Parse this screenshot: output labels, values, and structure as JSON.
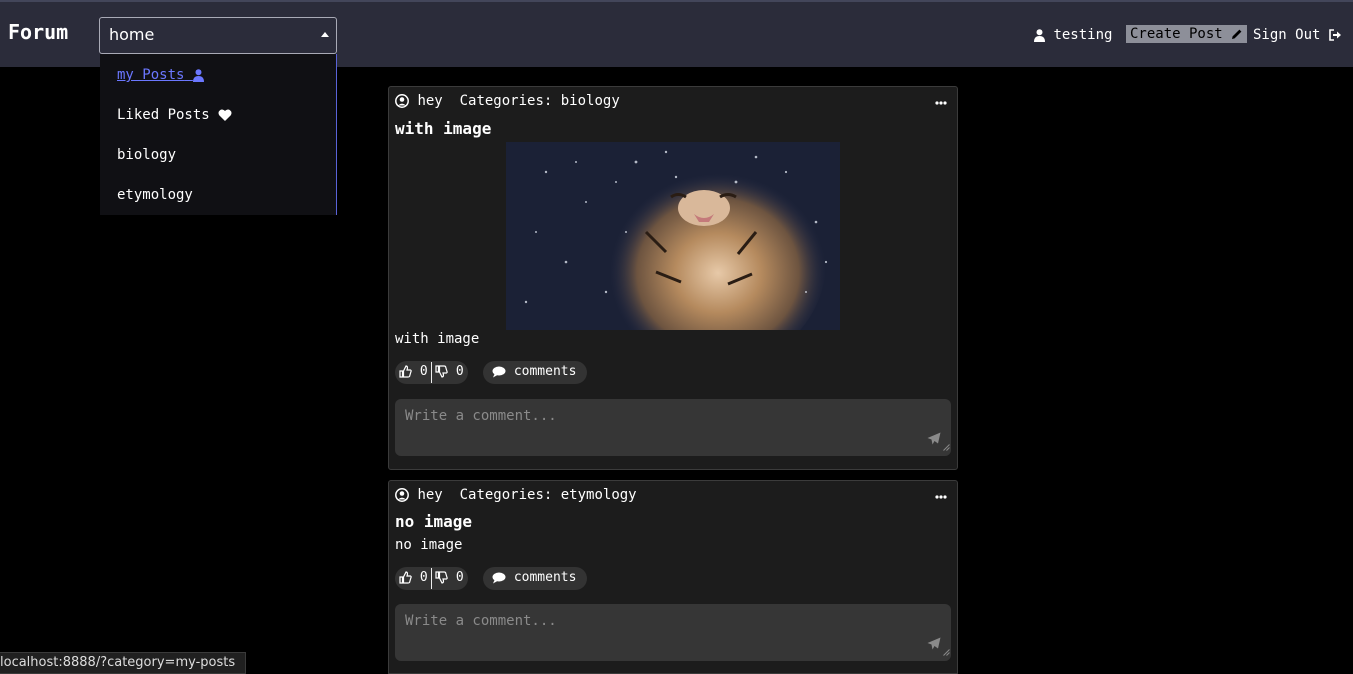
{
  "header": {
    "brand": "Forum",
    "category_select": {
      "value": "home"
    },
    "user_name": "testing",
    "create_post_label": "Create Post",
    "sign_out_label": "Sign Out"
  },
  "dropdown": {
    "items": [
      {
        "label": "my Posts",
        "icon": "user-icon"
      },
      {
        "label": "Liked Posts",
        "icon": "heart-icon"
      },
      {
        "label": "biology"
      },
      {
        "label": "etymology"
      }
    ]
  },
  "posts": [
    {
      "author": "hey",
      "categories_label": "Categories:",
      "category": "biology",
      "title": "with image",
      "image": "tiger shaking off water",
      "body": "with image",
      "likes": "0",
      "dislikes": "0",
      "comments_label": "comments",
      "comment_placeholder": "Write a comment..."
    },
    {
      "author": "hey",
      "categories_label": "Categories:",
      "category": "etymology",
      "title": "no image",
      "body": "no image",
      "likes": "0",
      "dislikes": "0",
      "comments_label": "comments",
      "comment_placeholder": "Write a comment..."
    }
  ],
  "status_bar": {
    "url": "localhost:8888/?category=my-posts"
  },
  "colors": {
    "header_bg": "#2b2c3a",
    "card_bg": "#1c1c1c",
    "link_active": "#6b77ff",
    "create_button_bg": "#8d8f99"
  }
}
